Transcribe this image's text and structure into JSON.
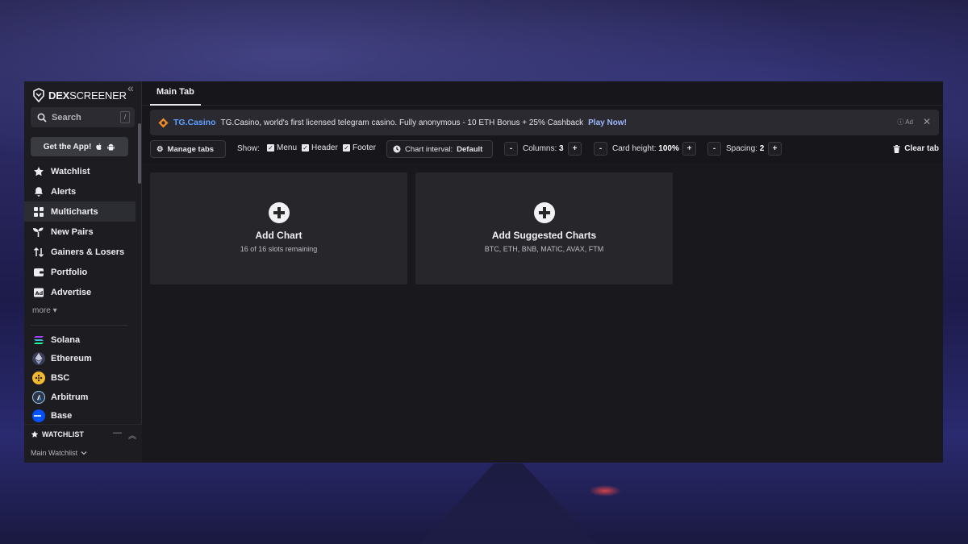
{
  "brand": {
    "name_bold": "DEX",
    "name_rest": "SCREENER"
  },
  "sidebar": {
    "collapse_icon": "chevron-double-left",
    "search": {
      "label": "Search",
      "shortcut": "/"
    },
    "get_app_label": "Get the App!",
    "nav": [
      {
        "label": "Watchlist",
        "icon": "star-icon"
      },
      {
        "label": "Alerts",
        "icon": "bell-icon"
      },
      {
        "label": "Multicharts",
        "icon": "grid-icon",
        "active": true
      },
      {
        "label": "New Pairs",
        "icon": "sprout-icon"
      },
      {
        "label": "Gainers & Losers",
        "icon": "arrows-updown-icon"
      },
      {
        "label": "Portfolio",
        "icon": "wallet-icon"
      },
      {
        "label": "Advertise",
        "icon": "ad-icon"
      }
    ],
    "more_label": "more",
    "chains": [
      {
        "label": "Solana",
        "color": "#14f195"
      },
      {
        "label": "Ethereum",
        "color": "#8a92b2"
      },
      {
        "label": "BSC",
        "color": "#f3ba2f"
      },
      {
        "label": "Arbitrum",
        "color": "#2d374b"
      },
      {
        "label": "Base",
        "color": "#0052ff"
      }
    ],
    "watchlist": {
      "title": "WATCHLIST",
      "selected": "Main Watchlist"
    }
  },
  "main": {
    "tabs": [
      {
        "label": "Main Tab",
        "active": true
      }
    ],
    "ad": {
      "brand": "TG.Casino",
      "text": "TG.Casino, world's first licensed telegram casino. Fully anonymous - 10 ETH Bonus + 25% Cashback",
      "cta": "Play Now!",
      "tag": "Ad"
    },
    "toolbar": {
      "manage_tabs": "Manage tabs",
      "show_label": "Show:",
      "show_menu": "Menu",
      "show_header": "Header",
      "show_footer": "Footer",
      "chart_interval_label": "Chart interval:",
      "chart_interval_value": "Default",
      "columns_label": "Columns:",
      "columns_value": "3",
      "card_height_label": "Card height:",
      "card_height_value": "100%",
      "spacing_label": "Spacing:",
      "spacing_value": "2",
      "minus": "-",
      "plus": "+",
      "clear_tab": "Clear tab"
    },
    "cards": [
      {
        "title": "Add Chart",
        "subtitle": "16 of 16 slots remaining"
      },
      {
        "title": "Add Suggested Charts",
        "subtitle": "BTC, ETH, BNB, MATIC, AVAX, FTM"
      }
    ]
  },
  "colors": {
    "accent_blue": "#5ea0ff",
    "panel": "#17171b",
    "card": "#26262b"
  }
}
